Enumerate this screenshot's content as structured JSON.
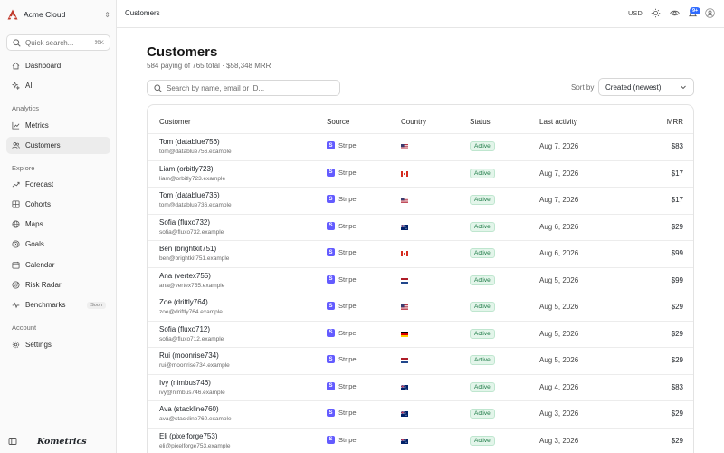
{
  "workspace": {
    "name": "Acme Cloud"
  },
  "sidebar": {
    "search_placeholder": "Quick search...",
    "search_shortcut": "⌘K",
    "items_top": [
      {
        "label": "Dashboard",
        "icon": "home-icon"
      },
      {
        "label": "AI",
        "icon": "sparkle-icon"
      }
    ],
    "section_analytics": "Analytics",
    "items_analytics": [
      {
        "label": "Metrics",
        "icon": "chart-icon"
      },
      {
        "label": "Customers",
        "icon": "users-icon",
        "active": true
      }
    ],
    "section_explore": "Explore",
    "items_explore": [
      {
        "label": "Forecast",
        "icon": "trend-icon"
      },
      {
        "label": "Cohorts",
        "icon": "grid-icon"
      },
      {
        "label": "Maps",
        "icon": "globe-icon"
      },
      {
        "label": "Goals",
        "icon": "target-icon"
      },
      {
        "label": "Calendar",
        "icon": "calendar-icon"
      },
      {
        "label": "Risk Radar",
        "icon": "radar-icon"
      },
      {
        "label": "Benchmarks",
        "icon": "pulse-icon",
        "badge": "Soon"
      }
    ],
    "section_account": "Account",
    "items_account": [
      {
        "label": "Settings",
        "icon": "gear-icon"
      }
    ],
    "brand": "Kometrics"
  },
  "topbar": {
    "breadcrumb": "Customers",
    "currency": "USD",
    "notifications": "9+"
  },
  "page": {
    "title": "Customers",
    "subtitle": "584 paying of 765 total · $58,348 MRR",
    "search_placeholder": "Search by name, email or ID...",
    "sort_label": "Sort by",
    "sort_value": "Created (newest)"
  },
  "table": {
    "columns": [
      "Customer",
      "Source",
      "Country",
      "Status",
      "Last activity",
      "MRR"
    ],
    "rows": [
      {
        "name": "Tom (datablue756)",
        "email": "tom@datablue756.example",
        "source": "Stripe",
        "country": "US",
        "status": "Active",
        "last_activity": "Aug 7, 2026",
        "mrr": "$83"
      },
      {
        "name": "Liam (orbitly723)",
        "email": "liam@orbitly723.example",
        "source": "Stripe",
        "country": "CA",
        "status": "Active",
        "last_activity": "Aug 7, 2026",
        "mrr": "$17"
      },
      {
        "name": "Tom (datablue736)",
        "email": "tom@datablue736.example",
        "source": "Stripe",
        "country": "US",
        "status": "Active",
        "last_activity": "Aug 7, 2026",
        "mrr": "$17"
      },
      {
        "name": "Sofia (fluxo732)",
        "email": "sofia@fluxo732.example",
        "source": "Stripe",
        "country": "AU",
        "status": "Active",
        "last_activity": "Aug 6, 2026",
        "mrr": "$29"
      },
      {
        "name": "Ben (brightkit751)",
        "email": "ben@brightkit751.example",
        "source": "Stripe",
        "country": "CA",
        "status": "Active",
        "last_activity": "Aug 6, 2026",
        "mrr": "$99"
      },
      {
        "name": "Ana (vertex755)",
        "email": "ana@vertex755.example",
        "source": "Stripe",
        "country": "NL",
        "status": "Active",
        "last_activity": "Aug 5, 2026",
        "mrr": "$99"
      },
      {
        "name": "Zoe (driftly764)",
        "email": "zoe@driftly764.example",
        "source": "Stripe",
        "country": "US",
        "status": "Active",
        "last_activity": "Aug 5, 2026",
        "mrr": "$29"
      },
      {
        "name": "Sofia (fluxo712)",
        "email": "sofia@fluxo712.example",
        "source": "Stripe",
        "country": "DE",
        "status": "Active",
        "last_activity": "Aug 5, 2026",
        "mrr": "$29"
      },
      {
        "name": "Rui (moonrise734)",
        "email": "rui@moonrise734.example",
        "source": "Stripe",
        "country": "NL",
        "status": "Active",
        "last_activity": "Aug 5, 2026",
        "mrr": "$29"
      },
      {
        "name": "Ivy (nimbus746)",
        "email": "ivy@nimbus746.example",
        "source": "Stripe",
        "country": "AU",
        "status": "Active",
        "last_activity": "Aug 4, 2026",
        "mrr": "$83"
      },
      {
        "name": "Ava (stackline760)",
        "email": "ava@stackline760.example",
        "source": "Stripe",
        "country": "AU",
        "status": "Active",
        "last_activity": "Aug 3, 2026",
        "mrr": "$29"
      },
      {
        "name": "Eli (pixelforge753)",
        "email": "eli@pixelforge753.example",
        "source": "Stripe",
        "country": "AU",
        "status": "Active",
        "last_activity": "Aug 3, 2026",
        "mrr": "$29"
      }
    ]
  },
  "colors": {
    "accent": "#2f6bff",
    "stripe": "#635bff",
    "active_text": "#1d7a46",
    "active_bg": "#e3f5ea"
  }
}
